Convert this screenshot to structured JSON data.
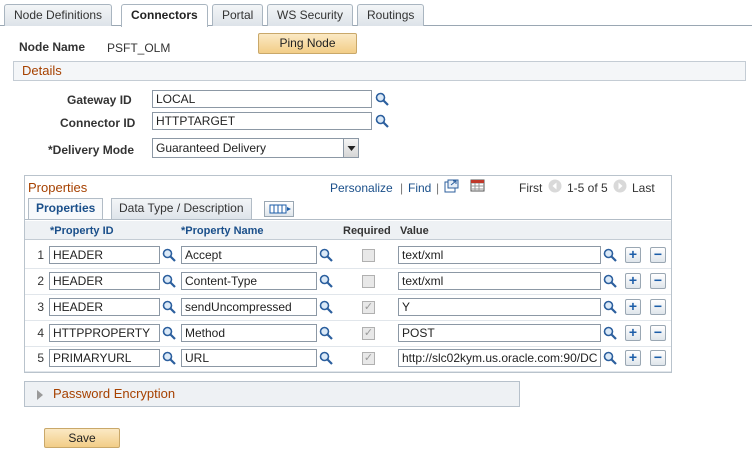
{
  "tabs": [
    {
      "label": "Node Definitions",
      "active": false
    },
    {
      "label": "Connectors",
      "active": true
    },
    {
      "label": "Portal",
      "active": false
    },
    {
      "label": "WS Security",
      "active": false
    },
    {
      "label": "Routings",
      "active": false
    }
  ],
  "node": {
    "label": "Node Name",
    "value": "PSFT_OLM"
  },
  "ping_button": "Ping Node",
  "details": {
    "title": "Details",
    "gateway_label": "Gateway ID",
    "gateway_value": "LOCAL",
    "connector_label": "Connector ID",
    "connector_value": "HTTPTARGET",
    "delivery_label": "*Delivery Mode",
    "delivery_value": "Guaranteed Delivery"
  },
  "properties": {
    "title": "Properties",
    "personalize": "Personalize",
    "separator": "|",
    "find": "Find",
    "first": "First",
    "range": "1-5 of 5",
    "last": "Last",
    "tab_properties": "Properties",
    "tab_datatype": "Data Type / Description",
    "columns": {
      "property_id": "*Property ID",
      "property_name": "*Property Name",
      "required": "Required",
      "value": "Value"
    },
    "rows": [
      {
        "num": "1",
        "id": "HEADER",
        "name": "Accept",
        "required": false,
        "value": "text/xml"
      },
      {
        "num": "2",
        "id": "HEADER",
        "name": "Content-Type",
        "required": false,
        "value": "text/xml"
      },
      {
        "num": "3",
        "id": "HEADER",
        "name": "sendUncompressed",
        "required": true,
        "value": "Y"
      },
      {
        "num": "4",
        "id": "HTTPPROPERTY",
        "name": "Method",
        "required": true,
        "value": "POST"
      },
      {
        "num": "5",
        "id": "PRIMARYURL",
        "name": "URL",
        "required": true,
        "value": "http://slc02kym.us.oracle.com:90/DC"
      }
    ],
    "add_symbol": "+",
    "remove_symbol": "−",
    "check_symbol": "✓"
  },
  "password_section": "Password Encryption",
  "save_button": "Save",
  "icons": {
    "lookup": "magnifier-icon",
    "expand": "triangle-right-icon",
    "zoom": "new-window-icon",
    "download": "grid-download-icon",
    "show_all_columns": "show-all-columns-icon"
  },
  "colors": {
    "section_title": "#a64100",
    "link": "#1a4f8a",
    "button": "#f2cd87"
  }
}
